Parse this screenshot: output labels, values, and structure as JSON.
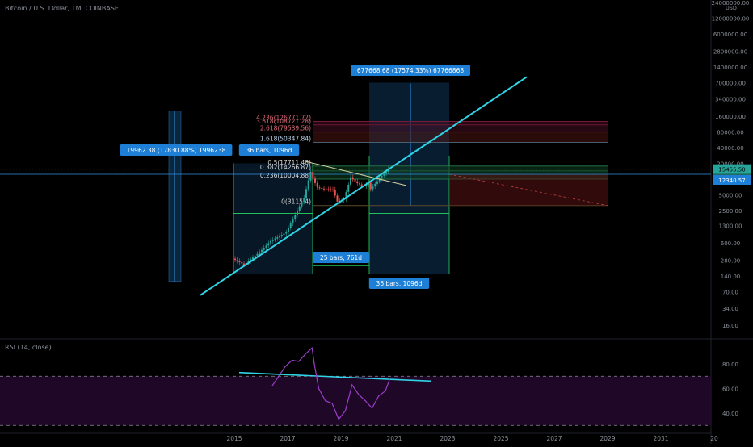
{
  "header": {
    "title": "Bitcoin / U.S. Dollar, 1M, COINBASE"
  },
  "rsi_title": "RSI (14, close)",
  "colors": {
    "background": "#000000",
    "up_candle": "#26a69a",
    "down_candle": "#ef5350",
    "trendline": "#2fd3e6",
    "rsi_line": "#9b3fc8",
    "rsi_band": "#2a0a36",
    "box_fill": "#0d2a44",
    "label_bg": "#1e7fd6",
    "green": "#22c25a",
    "red_zone": "#5a1414"
  },
  "chart_data": [
    {
      "type": "line",
      "title": "Bitcoin / U.S. Dollar, 1M, COINBASE",
      "scale": "log",
      "y_unit": "USD",
      "y_ticks": [
        "24000000.00",
        "12000000.00",
        "6000000.00",
        "2800000.00",
        "1400000.00",
        "700000.00",
        "340000.00",
        "160000.00",
        "80000.00",
        "40000.00",
        "20000.00",
        "10000.00",
        "5000.00",
        "2500.00",
        "1300.00",
        "600.00",
        "280.00",
        "140.00",
        "70.00",
        "34.00",
        "16.00"
      ],
      "x_ticks": [
        "2015",
        "2017",
        "2019",
        "2021",
        "2023",
        "2025",
        "2027",
        "2029",
        "2031",
        "20"
      ],
      "last_price_label": "15455.50",
      "countdown_label": "21d 21h",
      "horizontal_level_label": "12340.57",
      "axis_unit_label": "USD",
      "price_path": [
        [
          "2015-01",
          300
        ],
        [
          "2015-06",
          230
        ],
        [
          "2016-01",
          400
        ],
        [
          "2016-06",
          650
        ],
        [
          "2017-01",
          960
        ],
        [
          "2017-06",
          2500
        ],
        [
          "2017-09",
          4400
        ],
        [
          "2017-12",
          13800
        ],
        [
          "2018-01",
          10200
        ],
        [
          "2018-03",
          6900
        ],
        [
          "2018-06",
          6400
        ],
        [
          "2018-10",
          6300
        ],
        [
          "2018-12",
          3700
        ],
        [
          "2019-03",
          4100
        ],
        [
          "2019-06",
          10800
        ],
        [
          "2019-09",
          8300
        ],
        [
          "2019-12",
          7200
        ],
        [
          "2020-02",
          8500
        ],
        [
          "2020-03",
          6400
        ],
        [
          "2020-06",
          9100
        ],
        [
          "2020-08",
          11600
        ],
        [
          "2020-10",
          13800
        ],
        [
          "2020-11",
          15455
        ]
      ],
      "fib_levels": [
        {
          "label": "4.236(126771.77)",
          "value": 126771.77
        },
        {
          "label": "3.618(108721.28)",
          "value": 108721.28
        },
        {
          "label": "2.618(79539.56)",
          "value": 79539.56
        },
        {
          "label": "1.618(50347.84)",
          "value": 50347.84
        },
        {
          "label": "0.5(17711.48)",
          "value": 17711.48
        },
        {
          "label": "0.382(14266.87)",
          "value": 14266.87
        },
        {
          "label": "0.236(10004.88)",
          "value": 10004.88
        },
        {
          "label": "0(3115.4)",
          "value": 3115.4
        }
      ],
      "measure_labels": [
        "19962.38 (17830.88%) 1996238",
        "677668.68 (17574.33%) 67766868",
        "36 bars, 1096d",
        "25 bars, 761d",
        "36 bars, 1096d"
      ]
    },
    {
      "type": "line",
      "title": "RSI (14, close)",
      "y_ticks": [
        "80.00",
        "60.00",
        "40.00"
      ],
      "upper_band": 70,
      "lower_band": 30,
      "rsi_path": [
        [
          "2016-06",
          62
        ],
        [
          "2016-09",
          70
        ],
        [
          "2016-12",
          78
        ],
        [
          "2017-03",
          83
        ],
        [
          "2017-06",
          82
        ],
        [
          "2017-09",
          88
        ],
        [
          "2017-12",
          93
        ],
        [
          "2018-01",
          80
        ],
        [
          "2018-03",
          60
        ],
        [
          "2018-06",
          50
        ],
        [
          "2018-09",
          48
        ],
        [
          "2018-12",
          35
        ],
        [
          "2019-03",
          42
        ],
        [
          "2019-06",
          63
        ],
        [
          "2019-09",
          55
        ],
        [
          "2019-12",
          50
        ],
        [
          "2020-03",
          44
        ],
        [
          "2020-06",
          54
        ],
        [
          "2020-09",
          58
        ],
        [
          "2020-11",
          68
        ]
      ]
    }
  ]
}
